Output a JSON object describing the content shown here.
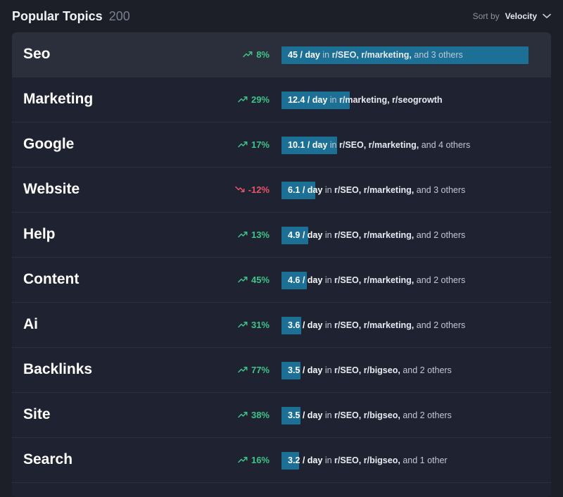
{
  "header": {
    "title": "Popular Topics",
    "count": "200",
    "sort_label": "Sort by",
    "sort_value": "Velocity"
  },
  "colors": {
    "background": "#1c1f28",
    "bar": "#1c6f95",
    "trend_up": "#3ec48a",
    "trend_down": "#e5566a"
  },
  "bar_max_rate": 45,
  "topics": [
    {
      "name": "Seo",
      "trend": "8%",
      "direction": "up",
      "rate_value": 45,
      "rate": "45 / day",
      "in": "in",
      "subs": "r/SEO, r/marketing,",
      "others": "and 3 others"
    },
    {
      "name": "Marketing",
      "trend": "29%",
      "direction": "up",
      "rate_value": 12.4,
      "rate": "12.4 / day",
      "in": "in",
      "subs": "r/marketing, r/seogrowth",
      "others": ""
    },
    {
      "name": "Google",
      "trend": "17%",
      "direction": "up",
      "rate_value": 10.1,
      "rate": "10.1 / day",
      "in": "in",
      "subs": "r/SEO, r/marketing,",
      "others": "and 4 others"
    },
    {
      "name": "Website",
      "trend": "-12%",
      "direction": "down",
      "rate_value": 6.1,
      "rate": "6.1 / day",
      "in": "in",
      "subs": "r/SEO, r/marketing,",
      "others": "and 3 others"
    },
    {
      "name": "Help",
      "trend": "13%",
      "direction": "up",
      "rate_value": 4.9,
      "rate": "4.9 / day",
      "in": "in",
      "subs": "r/SEO, r/marketing,",
      "others": "and 2 others"
    },
    {
      "name": "Content",
      "trend": "45%",
      "direction": "up",
      "rate_value": 4.6,
      "rate": "4.6 / day",
      "in": "in",
      "subs": "r/SEO, r/marketing,",
      "others": "and 2 others"
    },
    {
      "name": "Ai",
      "trend": "31%",
      "direction": "up",
      "rate_value": 3.6,
      "rate": "3.6 / day",
      "in": "in",
      "subs": "r/SEO, r/marketing,",
      "others": "and 2 others"
    },
    {
      "name": "Backlinks",
      "trend": "77%",
      "direction": "up",
      "rate_value": 3.5,
      "rate": "3.5 / day",
      "in": "in",
      "subs": "r/SEO, r/bigseo,",
      "others": "and 2 others"
    },
    {
      "name": "Site",
      "trend": "38%",
      "direction": "up",
      "rate_value": 3.5,
      "rate": "3.5 / day",
      "in": "in",
      "subs": "r/SEO, r/bigseo,",
      "others": "and 2 others"
    },
    {
      "name": "Search",
      "trend": "16%",
      "direction": "up",
      "rate_value": 3.2,
      "rate": "3.2 / day",
      "in": "in",
      "subs": "r/SEO, r/bigseo,",
      "others": "and 1 other"
    }
  ]
}
